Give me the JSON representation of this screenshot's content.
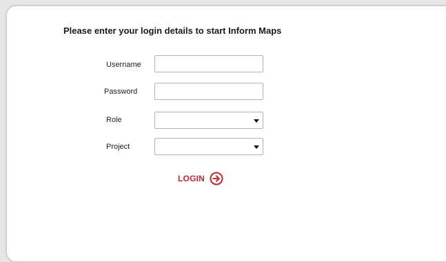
{
  "login_form": {
    "heading": "Please enter your login details to start Inform Maps",
    "username": {
      "label": "Username",
      "value": "",
      "placeholder": ""
    },
    "password": {
      "label": "Password",
      "value": "",
      "placeholder": ""
    },
    "role": {
      "label": "Role",
      "selected": ""
    },
    "project": {
      "label": "Project",
      "selected": ""
    },
    "login_button": {
      "label": "LOGIN",
      "icon": "arrow-right-circle-icon"
    }
  },
  "colors": {
    "accent": "#c8262b",
    "panel_background": "#ffffff",
    "page_background": "#e6e6e6"
  }
}
